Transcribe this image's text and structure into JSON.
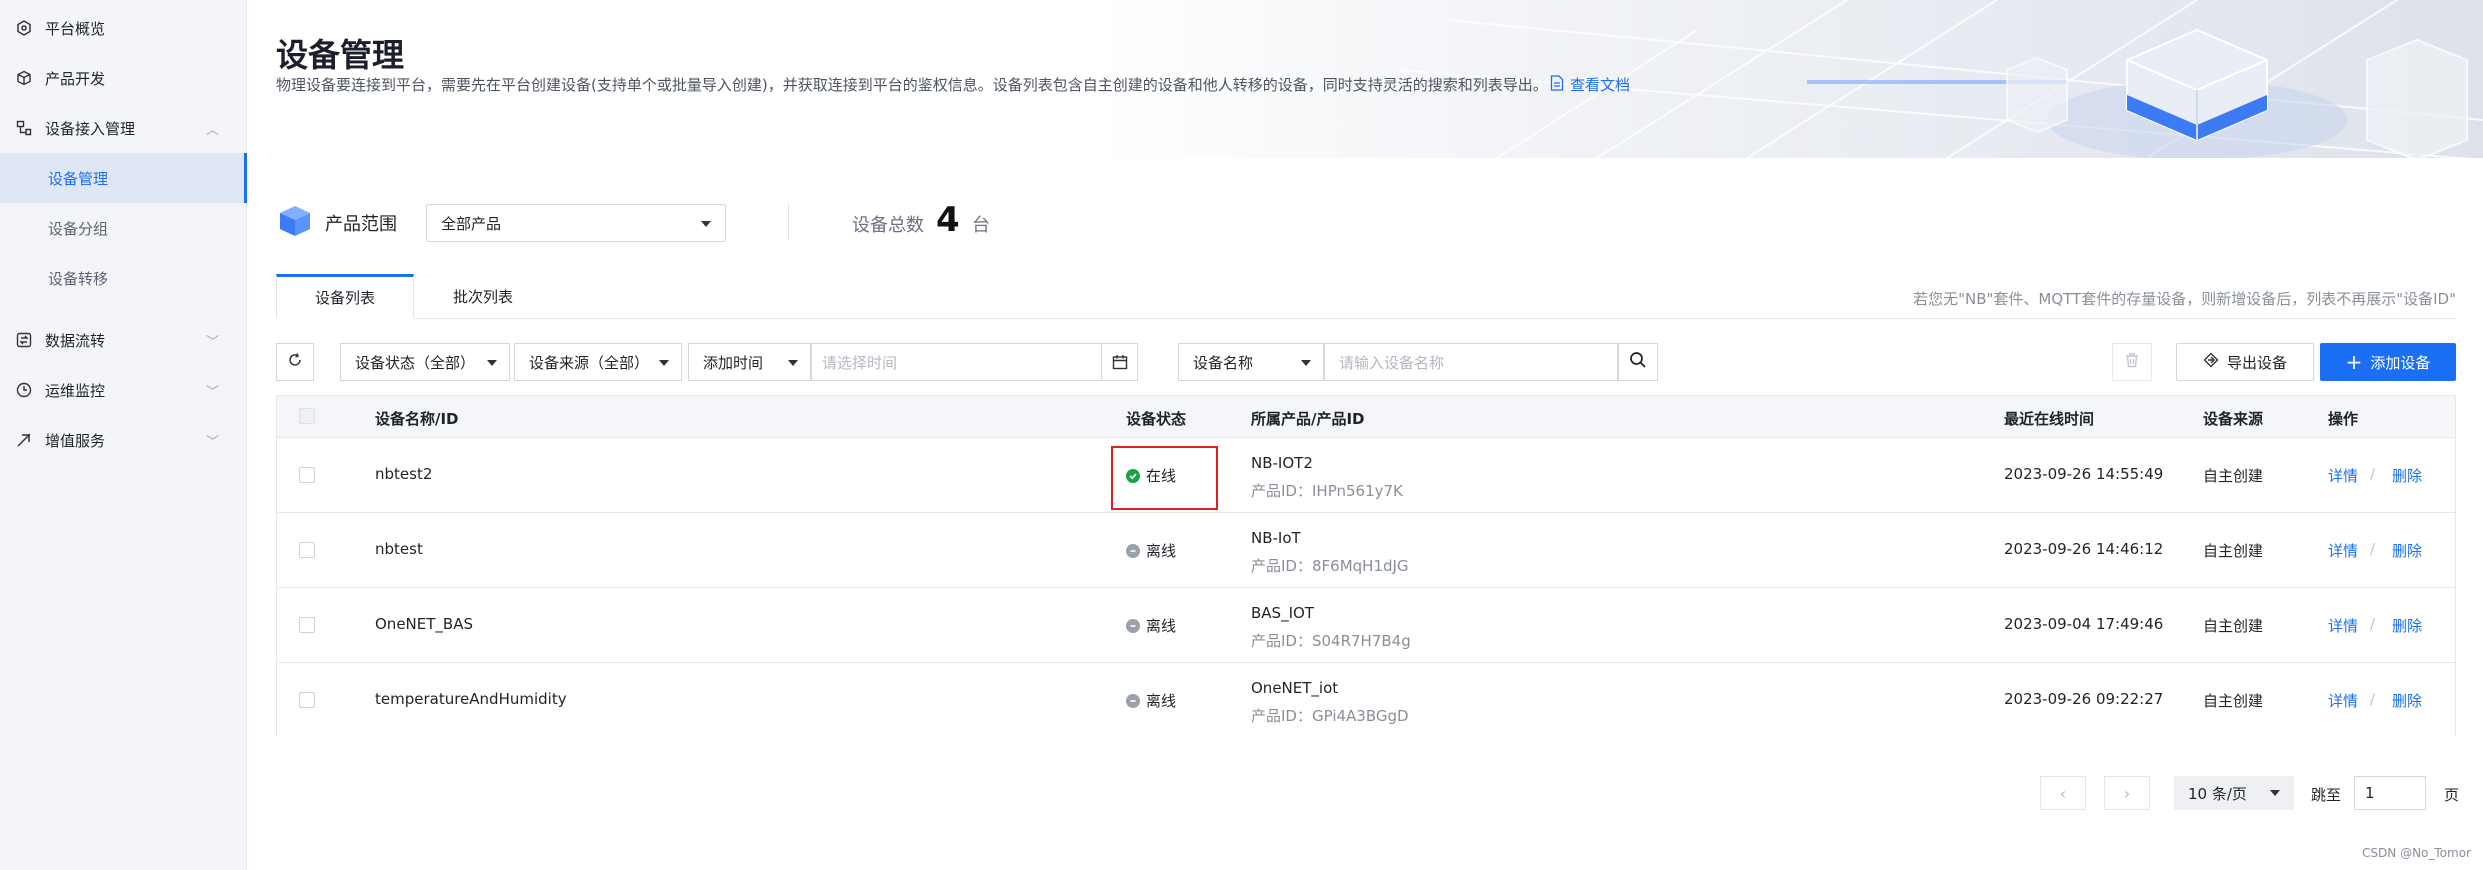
{
  "sidebar": {
    "items": [
      {
        "label": "平台概览",
        "icon": "dashboard-icon"
      },
      {
        "label": "产品开发",
        "icon": "cube-icon"
      },
      {
        "label": "设备接入管理",
        "icon": "device-access-icon",
        "expanded": true
      },
      {
        "label": "数据流转",
        "icon": "data-flow-icon"
      },
      {
        "label": "运维监控",
        "icon": "monitor-icon"
      },
      {
        "label": "增值服务",
        "icon": "value-service-icon"
      }
    ],
    "sub_items": [
      {
        "label": "设备管理",
        "active": true
      },
      {
        "label": "设备分组"
      },
      {
        "label": "设备转移"
      }
    ]
  },
  "header": {
    "title": "设备管理",
    "description": "物理设备要连接到平台，需要先在平台创建设备(支持单个或批量导入创建)，并获取连接到平台的鉴权信息。设备列表包含自主创建的设备和他人转移的设备，同时支持灵活的搜索和列表导出。",
    "doc_link": "查看文档"
  },
  "range": {
    "label": "产品范围",
    "select_value": "全部产品",
    "total_label": "设备总数",
    "total_count": "4",
    "total_unit": "台"
  },
  "tabs": [
    {
      "label": "设备列表",
      "active": true
    },
    {
      "label": "批次列表"
    }
  ],
  "tab_hint": "若您无\"NB\"套件、MQTT套件的存量设备，则新增设备后，列表不再展示\"设备ID\"",
  "filters": {
    "status": "设备状态（全部）",
    "source": "设备来源（全部）",
    "time_field": "添加时间",
    "time_placeholder": "请选择时间",
    "search_field": "设备名称",
    "search_placeholder": "请输入设备名称",
    "export_label": "导出设备",
    "add_label": "添加设备"
  },
  "table": {
    "columns": [
      "设备名称/ID",
      "设备状态",
      "所属产品/产品ID",
      "最近在线时间",
      "设备来源",
      "操作"
    ],
    "product_id_prefix": "产品ID：",
    "rows": [
      {
        "name": "nbtest2",
        "status": "在线",
        "online": true,
        "product": "NB-IOT2",
        "product_id": "IHPn561y7K",
        "last_online": "2023-09-26 14:55:49",
        "source": "自主创建",
        "op_detail": "详情",
        "op_delete": "删除"
      },
      {
        "name": "nbtest",
        "status": "离线",
        "online": false,
        "product": "NB-IoT",
        "product_id": "8F6MqH1dJG",
        "last_online": "2023-09-26 14:46:12",
        "source": "自主创建",
        "op_detail": "详情",
        "op_delete": "删除"
      },
      {
        "name": "OneNET_BAS",
        "status": "离线",
        "online": false,
        "product": "BAS_IOT",
        "product_id": "S04R7H7B4g",
        "last_online": "2023-09-04 17:49:46",
        "source": "自主创建",
        "op_detail": "详情",
        "op_delete": "删除"
      },
      {
        "name": "temperatureAndHumidity",
        "status": "离线",
        "online": false,
        "product": "OneNET_iot",
        "product_id": "GPi4A3BGgD",
        "last_online": "2023-09-26 09:22:27",
        "source": "自主创建",
        "op_detail": "详情",
        "op_delete": "删除"
      }
    ]
  },
  "pagination": {
    "page_size": "10 条/页",
    "jump_label": "跳至",
    "page_value": "1",
    "page_unit": "页"
  },
  "watermark": "CSDN @No_Tomor",
  "colors": {
    "accent": "#1b6ff5",
    "online": "#16a34a",
    "offline": "#9ba1aa",
    "highlight": "#e02020"
  }
}
